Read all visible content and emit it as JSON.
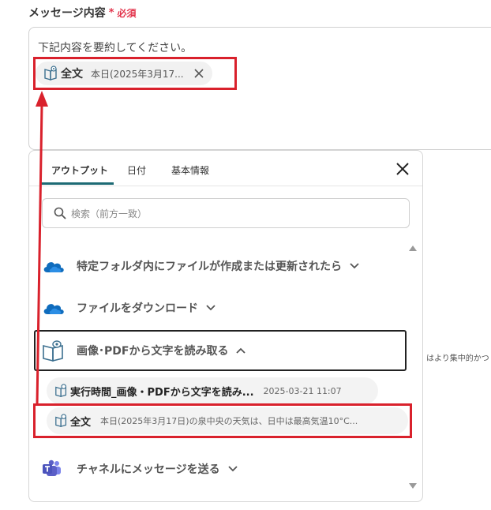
{
  "field": {
    "label": "メッセージ内容",
    "required_star": "*",
    "required_text": "必須"
  },
  "message": {
    "text": "下記内容を要約してください。",
    "chip": {
      "title": "全文",
      "value": "本日(2025年3月17..."
    }
  },
  "panel": {
    "tabs": [
      {
        "label": "アウトプット",
        "active": true
      },
      {
        "label": "日付",
        "active": false
      },
      {
        "label": "基本情報",
        "active": false
      }
    ],
    "search_placeholder": "検索（前方一致）",
    "sections": [
      {
        "label": "特定フォルダ内にファイルが作成または更新されたら",
        "icon": "onedrive-cloud-icon",
        "expanded": false
      },
      {
        "label": "ファイルをダウンロード",
        "icon": "onedrive-cloud-icon",
        "expanded": false
      },
      {
        "label": "画像･PDFから文字を読み取る",
        "icon": "ocr-book-icon",
        "expanded": true
      },
      {
        "label": "チャネルにメッセージを送る",
        "icon": "teams-icon",
        "expanded": false
      }
    ],
    "outputs": [
      {
        "title": "実行時間_画像・PDFから文字を読み...",
        "value": "2025-03-21 11:07"
      },
      {
        "title": "全文",
        "value": "本日(2025年3月17日)の泉中央の天気は、日中は最高気温10°C..."
      }
    ]
  },
  "background_text": "はより集中的かつ",
  "colors": {
    "required": "#e2324a",
    "highlight": "#d9212c",
    "tab_underline": "#1d6a74",
    "onedrive": "#0f6cbd",
    "teams": "#5b5fc7"
  }
}
